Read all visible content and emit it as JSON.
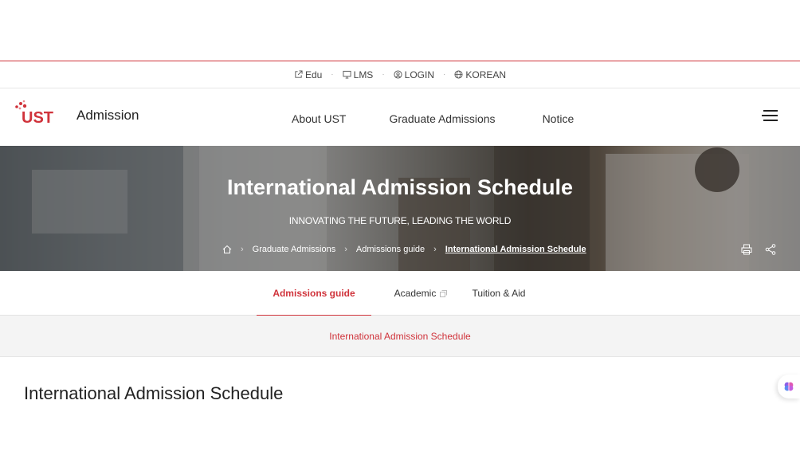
{
  "utility": {
    "items": [
      {
        "label": "Edu",
        "icon": "external-link-icon"
      },
      {
        "label": "LMS",
        "icon": "monitor-icon"
      },
      {
        "label": "LOGIN",
        "icon": "user-icon"
      },
      {
        "label": "KOREAN",
        "icon": "globe-icon"
      }
    ]
  },
  "header": {
    "logo_text": "UST",
    "brand_title": "Admission",
    "nav": [
      "About UST",
      "Graduate Admissions",
      "Notice"
    ]
  },
  "hero": {
    "title": "International Admission Schedule",
    "subtitle": "INNOVATING THE FUTURE, LEADING THE WORLD",
    "breadcrumb": [
      "Graduate Admissions",
      "Admissions guide",
      "International Admission Schedule"
    ]
  },
  "subtabs": {
    "items": [
      {
        "label": "Admissions guide",
        "active": true
      },
      {
        "label": "Academic",
        "active": false
      },
      {
        "label": "Tuition & Aid",
        "active": false
      }
    ]
  },
  "depth_bar": {
    "label": "International Admission Schedule"
  },
  "page": {
    "title": "International Admission Schedule"
  },
  "colors": {
    "accent": "#d0333b",
    "text": "#222222"
  }
}
